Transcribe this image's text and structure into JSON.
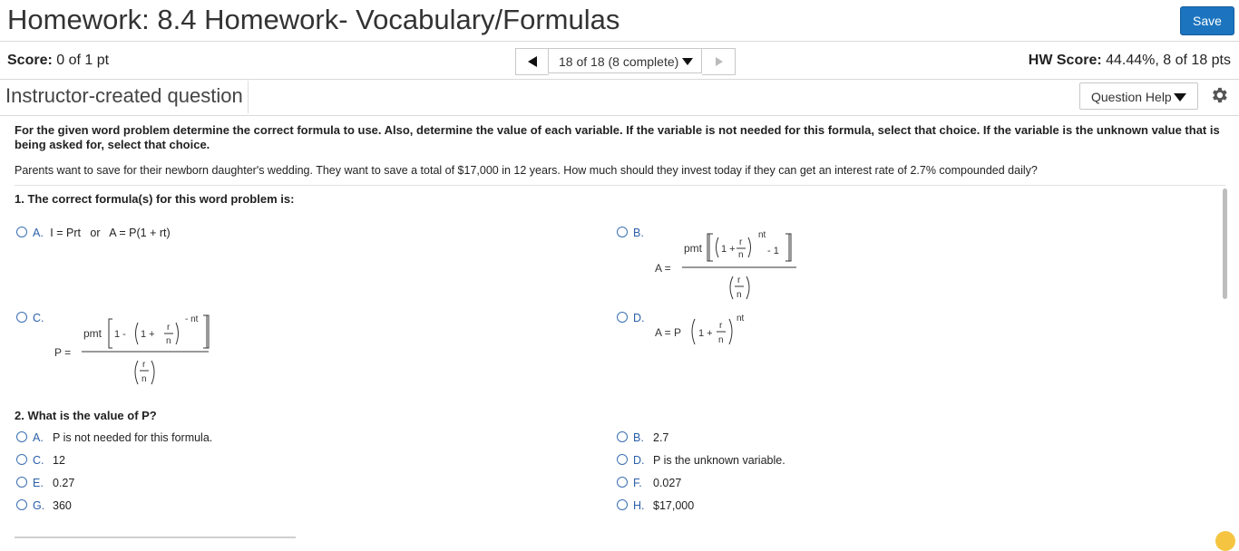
{
  "header": {
    "title": "Homework: 8.4 Homework- Vocabulary/Formulas",
    "save_label": "Save"
  },
  "score_row": {
    "score_label": "Score:",
    "score_value": "0 of 1 pt",
    "nav_select": "18 of 18 (8 complete)",
    "hw_score_label": "HW Score:",
    "hw_score_value": "44.44%, 8 of 18 pts"
  },
  "question_bar": {
    "type_label": "Instructor-created question",
    "help_label": "Question Help"
  },
  "content": {
    "instructions": "For the given word problem determine the correct formula to use. Also, determine the value of each variable. If the variable is not needed for this formula, select that choice. If the variable is the unknown value that is being asked for, select that choice.",
    "problem": "Parents want to save for their newborn daughter's wedding. They want to save a total of $17,000 in 12 years. How much should they invest today if they can get an interest rate of 2.7% compounded daily?",
    "q1": {
      "prompt": "1. The correct formula(s) for this word problem is:",
      "options": [
        {
          "letter": "A.",
          "text": "I = Prt   or   A = P(1 + rt)"
        },
        {
          "letter": "B.",
          "formula": "future-value-annuity"
        },
        {
          "letter": "C.",
          "formula": "present-value-annuity"
        },
        {
          "letter": "D.",
          "formula": "compound-interest"
        }
      ]
    },
    "q2": {
      "prompt": "2. What is the value of P?",
      "options": [
        {
          "letter": "A.",
          "text": "P is not needed for this formula."
        },
        {
          "letter": "B.",
          "text": "2.7"
        },
        {
          "letter": "C.",
          "text": "12"
        },
        {
          "letter": "D.",
          "text": "P is the unknown variable."
        },
        {
          "letter": "E.",
          "text": "0.27"
        },
        {
          "letter": "F.",
          "text": "0.027"
        },
        {
          "letter": "G.",
          "text": "360"
        },
        {
          "letter": "H.",
          "text": "$17,000"
        }
      ]
    }
  },
  "colors": {
    "accent": "#1c74bf",
    "radio": "#3a6fb3"
  }
}
